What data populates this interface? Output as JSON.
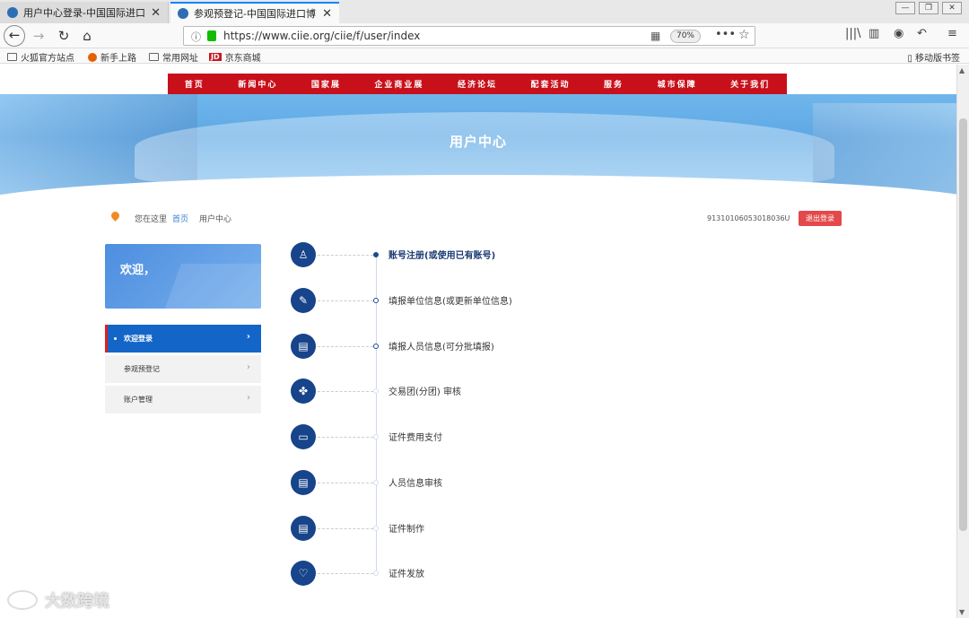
{
  "browser": {
    "tabs": [
      {
        "title": "用户中心登录-中国国际进口博",
        "active": false
      },
      {
        "title": "参观预登记-中国国际进口博览",
        "active": true
      }
    ],
    "url": "https://www.ciie.org/ciie/f/user/index",
    "zoom": "70%",
    "bookmarks": [
      "火狐官方站点",
      "新手上路",
      "常用网址",
      "京东商城"
    ],
    "mobile_bookmarks": "移动版书签"
  },
  "site": {
    "menu": [
      "首页",
      "新闻中心",
      "国家展",
      "企业商业展",
      "经济论坛",
      "配套活动",
      "服务",
      "城市保障",
      "关于我们"
    ],
    "banner_title": "用户中心",
    "breadcrumb": {
      "here": "您在这里",
      "home": "首页",
      "current": "用户中心"
    },
    "code": "91310106053018036U",
    "logout": "退出登录"
  },
  "sidebar": {
    "welcome": "欢迎，",
    "items": [
      {
        "label": "欢迎登录",
        "active": true
      },
      {
        "label": "参观预登记",
        "active": false
      },
      {
        "label": "账户管理",
        "active": false
      }
    ]
  },
  "steps": [
    {
      "icon": "user-icon",
      "glyph": "♙",
      "label": "账号注册(或使用已有账号)"
    },
    {
      "icon": "pen-icon",
      "glyph": "✎",
      "label": "填报单位信息(或更新单位信息)"
    },
    {
      "icon": "form-icon",
      "glyph": "▤",
      "label": "填报人员信息(可分批填报)"
    },
    {
      "icon": "group-icon",
      "glyph": "✤",
      "label": "交易团(分团) 审核"
    },
    {
      "icon": "card-icon",
      "glyph": "▭",
      "label": "证件费用支付"
    },
    {
      "icon": "review-icon",
      "glyph": "▤",
      "label": "人员信息审核"
    },
    {
      "icon": "make-icon",
      "glyph": "▤",
      "label": "证件制作"
    },
    {
      "icon": "heart-icon",
      "glyph": "♡",
      "label": "证件发放"
    }
  ],
  "watermark": "大数跨境"
}
